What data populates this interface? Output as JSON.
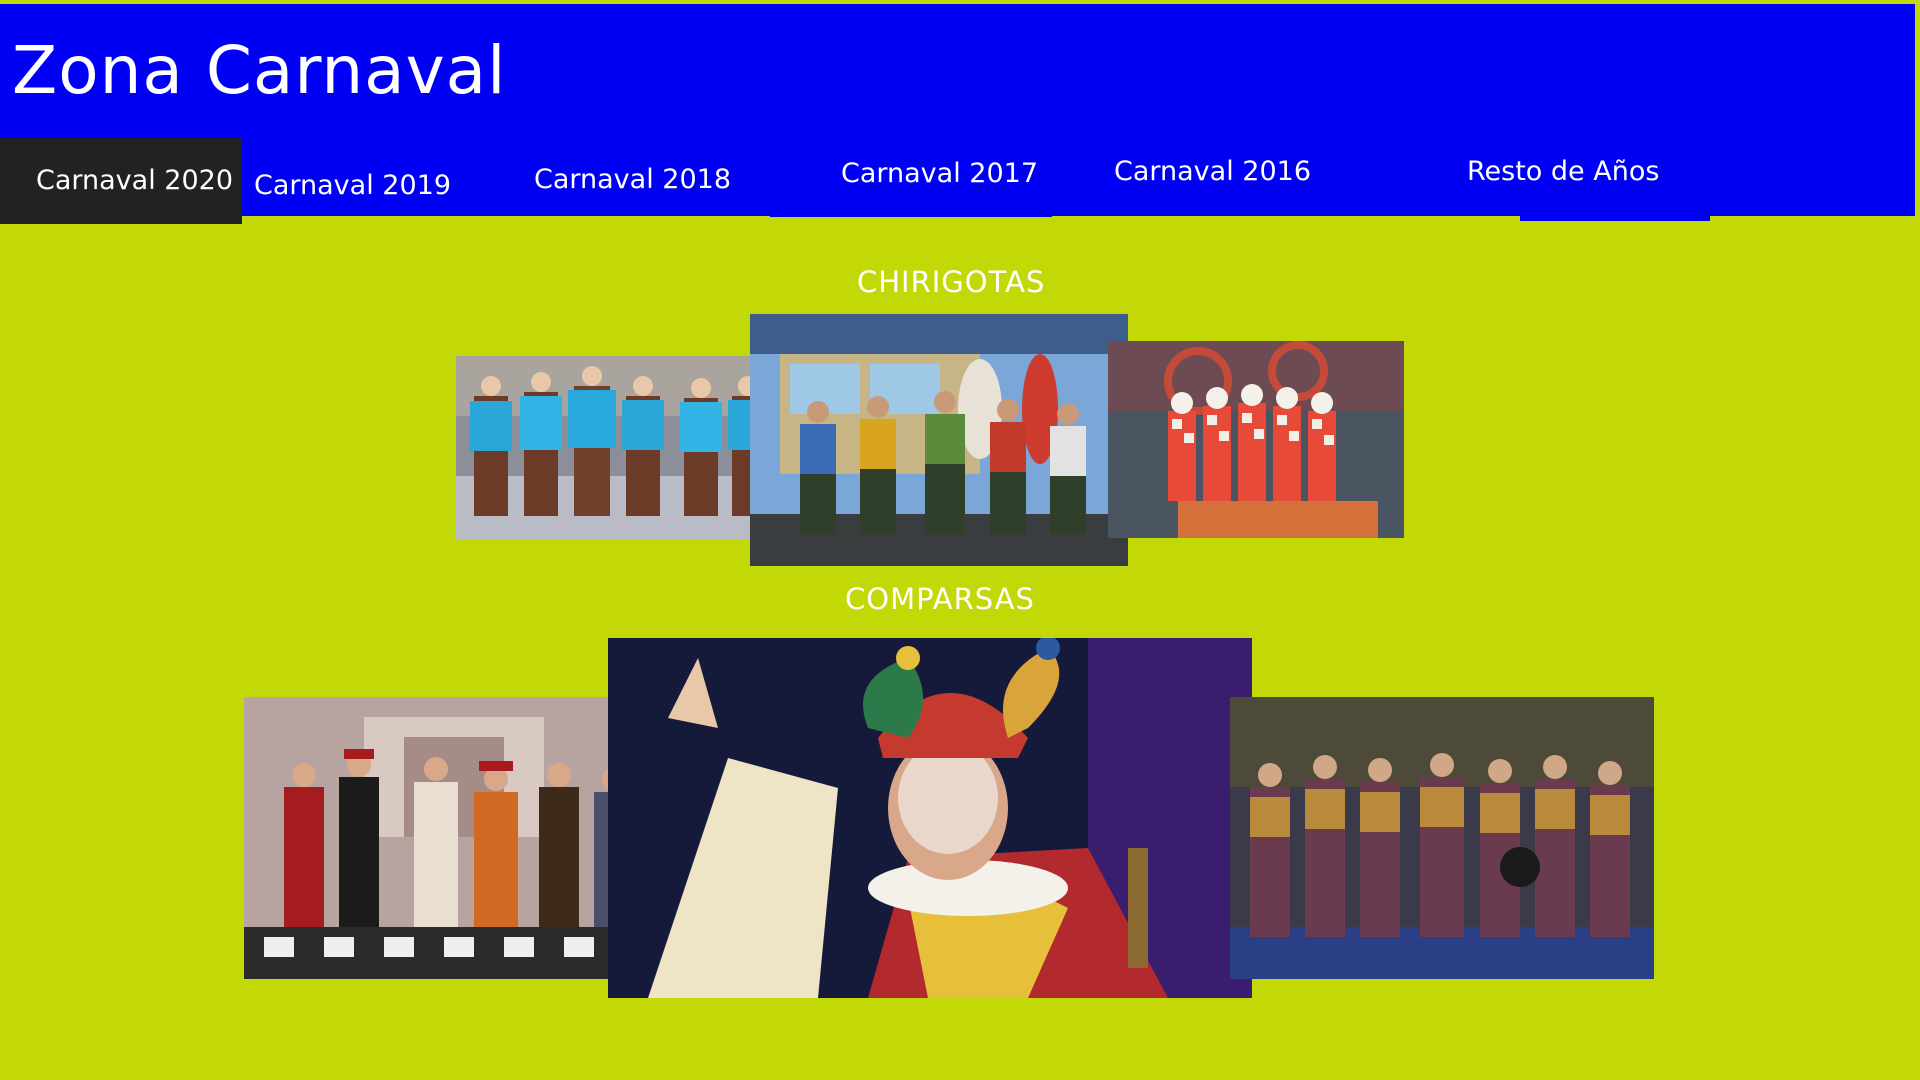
{
  "site": {
    "title": "Zona Carnaval"
  },
  "nav": {
    "items": [
      {
        "label": "Carnaval 2020"
      },
      {
        "label": "Carnaval 2019"
      },
      {
        "label": "Carnaval 2018"
      },
      {
        "label": "Carnaval 2017"
      },
      {
        "label": "Carnaval 2016"
      },
      {
        "label": "Resto de Años"
      }
    ]
  },
  "sections": {
    "chirigotas": {
      "heading": "CHIRIGOTAS",
      "photos": [
        {
          "name": "chirigota-photo-1",
          "description": "group in blue vests on stage"
        },
        {
          "name": "chirigota-photo-2",
          "description": "group with surfboards and van backdrop"
        },
        {
          "name": "chirigota-photo-3",
          "description": "group in harlequin costumes"
        }
      ]
    },
    "comparsas": {
      "heading": "COMPARSAS",
      "photos": [
        {
          "name": "comparsa-photo-1",
          "description": "baroque costumed group"
        },
        {
          "name": "comparsa-photo-2",
          "description": "jester close-up"
        },
        {
          "name": "comparsa-photo-3",
          "description": "group in chains on stage"
        }
      ]
    }
  },
  "colors": {
    "page_background": "#c2d807",
    "header_background": "#0000f5",
    "active_tab": "#222222",
    "text": "#ffffff"
  }
}
